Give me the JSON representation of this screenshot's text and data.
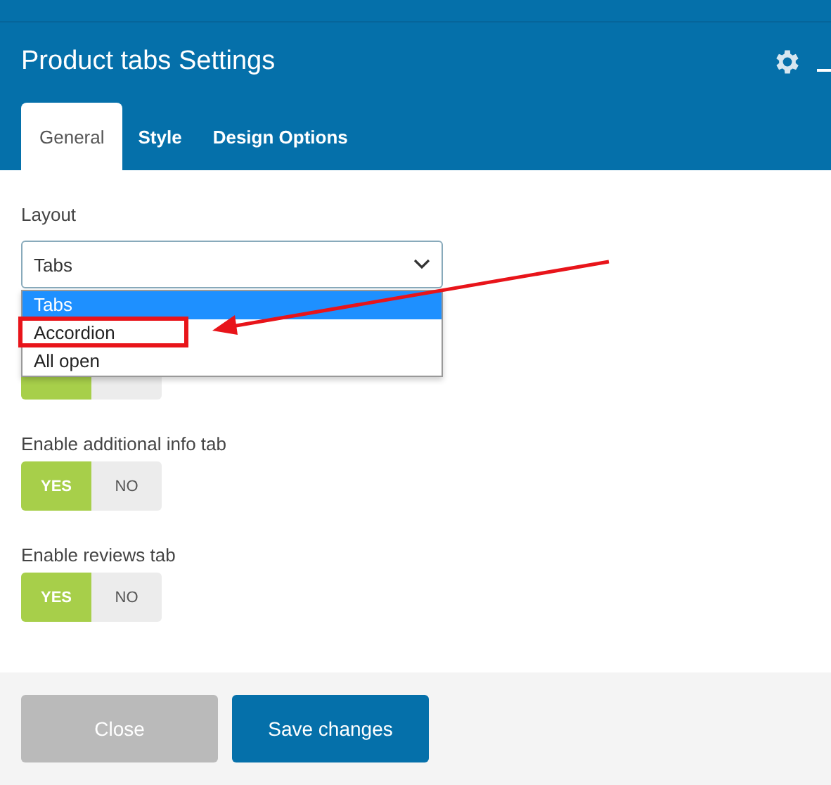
{
  "dialog": {
    "title": "Product tabs Settings"
  },
  "tabs": [
    {
      "label": "General",
      "selected": true
    },
    {
      "label": "Style",
      "selected": false
    },
    {
      "label": "Design Options",
      "selected": false
    }
  ],
  "layout_field": {
    "label": "Layout",
    "value": "Tabs",
    "options": [
      {
        "label": "Tabs",
        "selected": true,
        "highlighted": false
      },
      {
        "label": "Accordion",
        "selected": false,
        "highlighted": true
      },
      {
        "label": "All open",
        "selected": false,
        "highlighted": false
      }
    ]
  },
  "toggles": [
    {
      "on": true
    },
    {
      "label": "Enable additional info tab",
      "yes": "YES",
      "no": "NO",
      "on": true
    },
    {
      "label": "Enable reviews tab",
      "yes": "YES",
      "no": "NO",
      "on": true
    }
  ],
  "buttons": [
    {
      "label": "Close",
      "kind": "secondary"
    },
    {
      "label": "Save changes",
      "kind": "primary"
    }
  ]
}
